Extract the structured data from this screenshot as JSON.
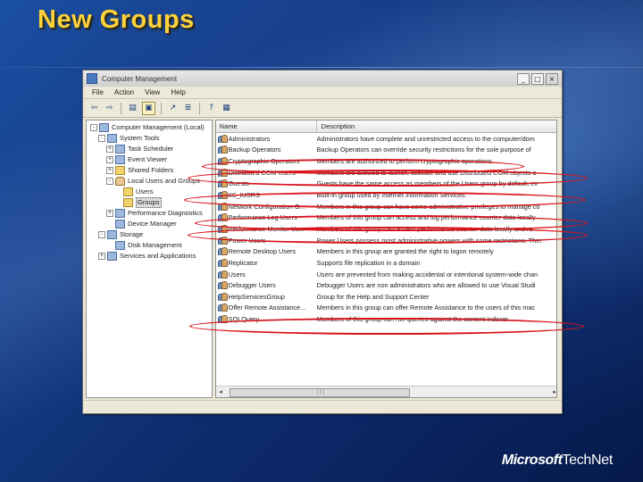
{
  "slide": {
    "title": "New Groups",
    "brand_ms": "Microsoft",
    "brand_tn": "TechNet"
  },
  "window": {
    "title": "Computer Management",
    "controls": [
      "_",
      "□",
      "×"
    ],
    "menu": [
      "File",
      "Action",
      "View",
      "Help"
    ]
  },
  "toolbar": {
    "icons": [
      "back-arrow-icon",
      "forward-arrow-icon",
      "up-folder-icon",
      "show-hide-tree-icon",
      "export-list-icon",
      "properties-icon",
      "help-icon",
      "view-icon"
    ]
  },
  "tree": {
    "items": [
      {
        "label": "Computer Management (Local)",
        "level": 0,
        "expander": "-",
        "icon": "computer-icon"
      },
      {
        "label": "System Tools",
        "level": 1,
        "expander": "-",
        "icon": "tools-icon"
      },
      {
        "label": "Task Scheduler",
        "level": 2,
        "expander": "+",
        "icon": "clock-icon"
      },
      {
        "label": "Event Viewer",
        "level": 2,
        "expander": "+",
        "icon": "event-icon"
      },
      {
        "label": "Shared Folders",
        "level": 2,
        "expander": "+",
        "icon": "folder-icon"
      },
      {
        "label": "Local Users and Groups",
        "level": 2,
        "expander": "-",
        "icon": "users-icon"
      },
      {
        "label": "Users",
        "level": 3,
        "expander": "",
        "icon": "folder-icon"
      },
      {
        "label": "Groups",
        "level": 3,
        "expander": "",
        "icon": "folder-icon",
        "selected": true
      },
      {
        "label": "Performance Diagnostics",
        "level": 2,
        "expander": "+",
        "icon": "chart-icon"
      },
      {
        "label": "Device Manager",
        "level": 2,
        "expander": "",
        "icon": "device-icon"
      },
      {
        "label": "Storage",
        "level": 1,
        "expander": "-",
        "icon": "storage-icon"
      },
      {
        "label": "Disk Management",
        "level": 2,
        "expander": "",
        "icon": "disk-icon"
      },
      {
        "label": "Services and Applications",
        "level": 1,
        "expander": "+",
        "icon": "services-icon"
      }
    ]
  },
  "list": {
    "columns": [
      "Name",
      "Description"
    ],
    "rows": [
      {
        "name": "Administrators",
        "desc": "Administrators have complete and unrestricted access to the computer/dom"
      },
      {
        "name": "Backup Operators",
        "desc": "Backup Operators can override security restrictions for the sole purpose of"
      },
      {
        "name": "Cryptographic Operators",
        "desc": "Members are authorized to perform cryptographic operations.",
        "highlighted": true
      },
      {
        "name": "Distributed COM Users",
        "desc": "Members are allowed to launch, activate and use Distributed COM objects o",
        "highlighted": true
      },
      {
        "name": "Guests",
        "desc": "Guests have the same access as members of the Users group by default, ex"
      },
      {
        "name": "IIS_IUSRS",
        "desc": "Built-in group used by Internet Information Services.",
        "highlighted": true
      },
      {
        "name": "Network Configuration O...",
        "desc": "Members in this group can have some administrative privileges to manage co"
      },
      {
        "name": "Performance Log Users",
        "desc": "Members of this group can access and log performance counter data locally",
        "highlighted": true
      },
      {
        "name": "Performance Monitor Us...",
        "desc": "Members of this group can access performance counter data locally and re",
        "highlighted": true
      },
      {
        "name": "Power Users",
        "desc": "Power Users possess most administrative powers with some restrictions. Ther"
      },
      {
        "name": "Remote Desktop Users",
        "desc": "Members in this group are granted the right to logon remotely"
      },
      {
        "name": "Replicator",
        "desc": "Supports file replication in a domain"
      },
      {
        "name": "Users",
        "desc": "Users are prevented from making accidental or intentional system-wide chan"
      },
      {
        "name": "Debugger Users",
        "desc": "Debugger Users are non administrators who are allowed to use Visual Studi"
      },
      {
        "name": "HelpServicesGroup",
        "desc": "Group for the Help and Support Center"
      },
      {
        "name": "Offer Remote Assistance...",
        "desc": "Members in this group can offer Remote Assistance to the users of this mac"
      },
      {
        "name": "SQLQuery",
        "desc": "Members of this group can run queries against the content indexer",
        "highlighted": true
      }
    ]
  },
  "colors": {
    "title_yellow": "#ffd23a",
    "highlight_red": "#d8141a",
    "bg_blue": "#163c86"
  }
}
